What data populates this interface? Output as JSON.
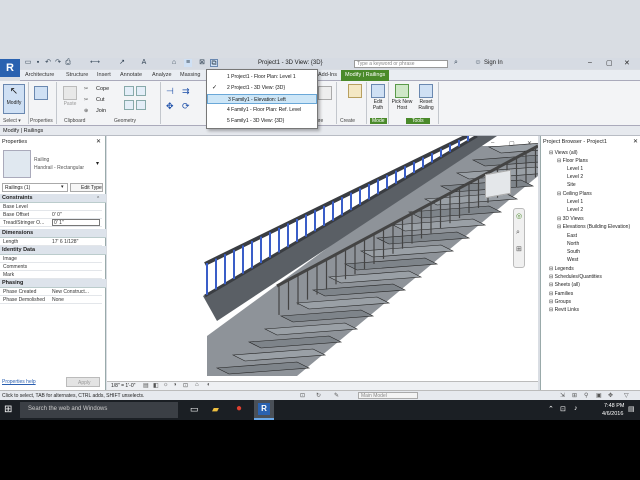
{
  "app": {
    "logo": "R",
    "doc_title": "Project1 - 3D View: {3D}",
    "search_placeholder": "Type a keyword or phrase",
    "sign_in": "Sign In"
  },
  "tabs": [
    "Architecture",
    "Structure",
    "Insert",
    "Annotate",
    "Analyze",
    "Massing",
    "Add-Ins",
    "Modify | Railings"
  ],
  "ribbon": {
    "modify": "Modify",
    "paste": "Paste",
    "cope": "Cope",
    "cut": "Cut",
    "join": "Join",
    "edit_path": "Edit Path",
    "pick_new_host": "Pick New Host",
    "reset_railing": "Reset Railing",
    "groups": [
      "Select",
      "Properties",
      "Clipboard",
      "Geometry",
      "Create",
      "Mode",
      "Tools"
    ],
    "partial_group": "ure",
    "select_dd": "Select ▾",
    "props_label": "Properties"
  },
  "context_label": "Modify | Railings",
  "dropdown_items": [
    {
      "label": "1 Project1 - Floor Plan: Level 1",
      "checked": false
    },
    {
      "label": "2 Project1 - 3D View: {3D}",
      "checked": true
    },
    {
      "label": "3 Family1 - Elevation: Left",
      "checked": false,
      "hovered": true
    },
    {
      "label": "4 Family1 - Floor Plan: Ref. Level",
      "checked": false
    },
    {
      "label": "5 Family1 - 3D View: {3D}",
      "checked": false
    }
  ],
  "properties": {
    "title": "Properties",
    "type_family": "Railing",
    "type_name": "Handrail - Rectangular",
    "selector": "Railings (1)",
    "edit_type": "Edit Type",
    "sections": [
      {
        "name": "Constraints",
        "rows": [
          [
            "Base Level",
            ""
          ],
          [
            "Base Offset",
            "0' 0\""
          ],
          [
            "Tread/Stringer O...",
            "0' 1\""
          ]
        ]
      },
      {
        "name": "Dimensions",
        "rows": [
          [
            "Length",
            "17' 6 1/128\""
          ]
        ]
      },
      {
        "name": "Identity Data",
        "rows": [
          [
            "Image",
            ""
          ],
          [
            "Comments",
            ""
          ],
          [
            "Mark",
            ""
          ]
        ]
      },
      {
        "name": "Phasing",
        "rows": [
          [
            "Phase Created",
            "New Construct..."
          ],
          [
            "Phase Demolished",
            "None"
          ]
        ]
      }
    ],
    "help": "Properties help",
    "apply": "Apply"
  },
  "browser": {
    "title": "Project Browser - Project1",
    "items": [
      {
        "t": "Views (all)",
        "lvl": 0
      },
      {
        "t": "Floor Plans",
        "lvl": 1
      },
      {
        "t": "Level 1",
        "lvl": 2
      },
      {
        "t": "Level 2",
        "lvl": 2
      },
      {
        "t": "Site",
        "lvl": 2
      },
      {
        "t": "Ceiling Plans",
        "lvl": 1
      },
      {
        "t": "Level 1",
        "lvl": 2
      },
      {
        "t": "Level 2",
        "lvl": 2
      },
      {
        "t": "3D Views",
        "lvl": 1
      },
      {
        "t": "Elevations (Building Elevation)",
        "lvl": 1
      },
      {
        "t": "East",
        "lvl": 2
      },
      {
        "t": "North",
        "lvl": 2
      },
      {
        "t": "South",
        "lvl": 2
      },
      {
        "t": "West",
        "lvl": 2
      },
      {
        "t": "Legends",
        "lvl": 0
      },
      {
        "t": "Schedules/Quantities",
        "lvl": 0
      },
      {
        "t": "Sheets (all)",
        "lvl": 0
      },
      {
        "t": "Families",
        "lvl": 0
      },
      {
        "t": "Groups",
        "lvl": 0
      },
      {
        "t": "Revit Links",
        "lvl": 0
      }
    ]
  },
  "viewbar": {
    "scale": "1/8\" = 1'-0\"",
    "model": "Main Model"
  },
  "status": "Click to select, TAB for alternates, CTRL adds, SHIFT unselects.",
  "taskbar": {
    "search": "Search the web and Windows",
    "time": "7:48 PM",
    "date": "4/6/2016"
  },
  "colors": {
    "accent": "#4a8a2a",
    "baluster": "#3a5ec8",
    "taskbar": "#1b1f24"
  }
}
